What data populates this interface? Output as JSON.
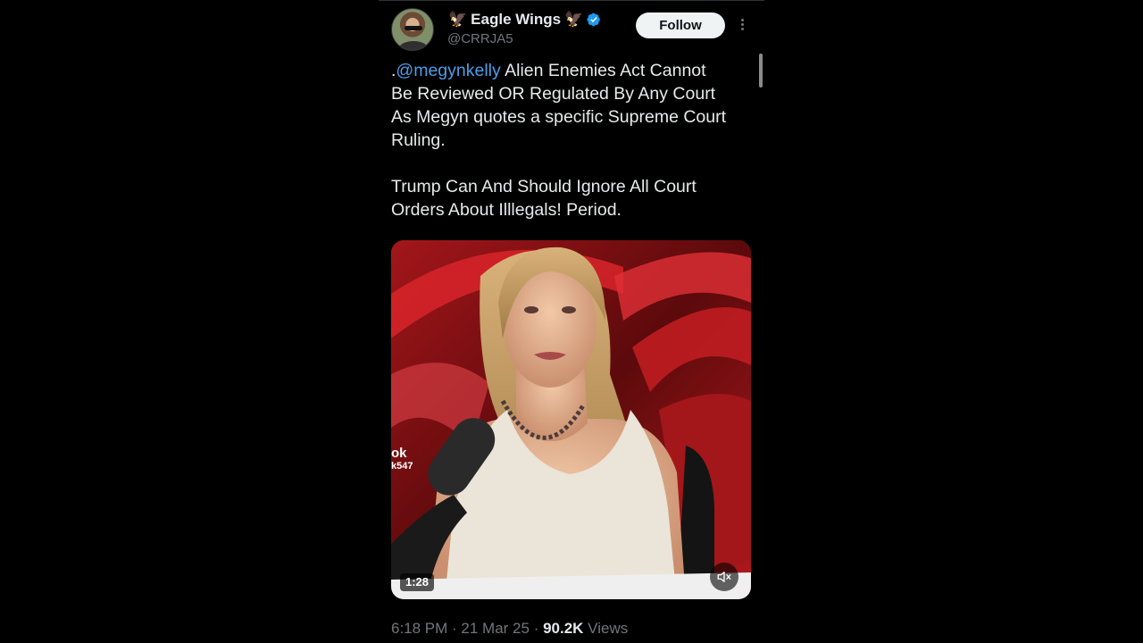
{
  "author": {
    "display_name": "Eagle Wings",
    "emoji_left": "🦅",
    "emoji_right": "🦅",
    "handle": "@CRRJA5",
    "verified": true
  },
  "follow_button": {
    "label": "Follow"
  },
  "tweet": {
    "prefix": ".",
    "mention": "@megynkelly",
    "text_after_mention": " Alien Enemies Act Cannot\nBe Reviewed OR Regulated By Any Court\nAs Megyn quotes a specific Supreme Court\nRuling.\n\nTrump Can And Should Ignore All Court\nOrders About Illlegals! Period."
  },
  "media": {
    "type": "video",
    "duration": "1:28",
    "overlay_line1": "ok",
    "overlay_line2": "k547",
    "muted": true
  },
  "meta": {
    "time": "6:18 PM",
    "separator": " · ",
    "date": "21 Mar 25",
    "views_count": "90.2K",
    "views_label": " Views"
  },
  "colors": {
    "background": "#000000",
    "text": "#e7e9ea",
    "secondary_text": "#71767b",
    "mention": "#4c9ee8",
    "verified_badge": "#1d9bf0"
  }
}
